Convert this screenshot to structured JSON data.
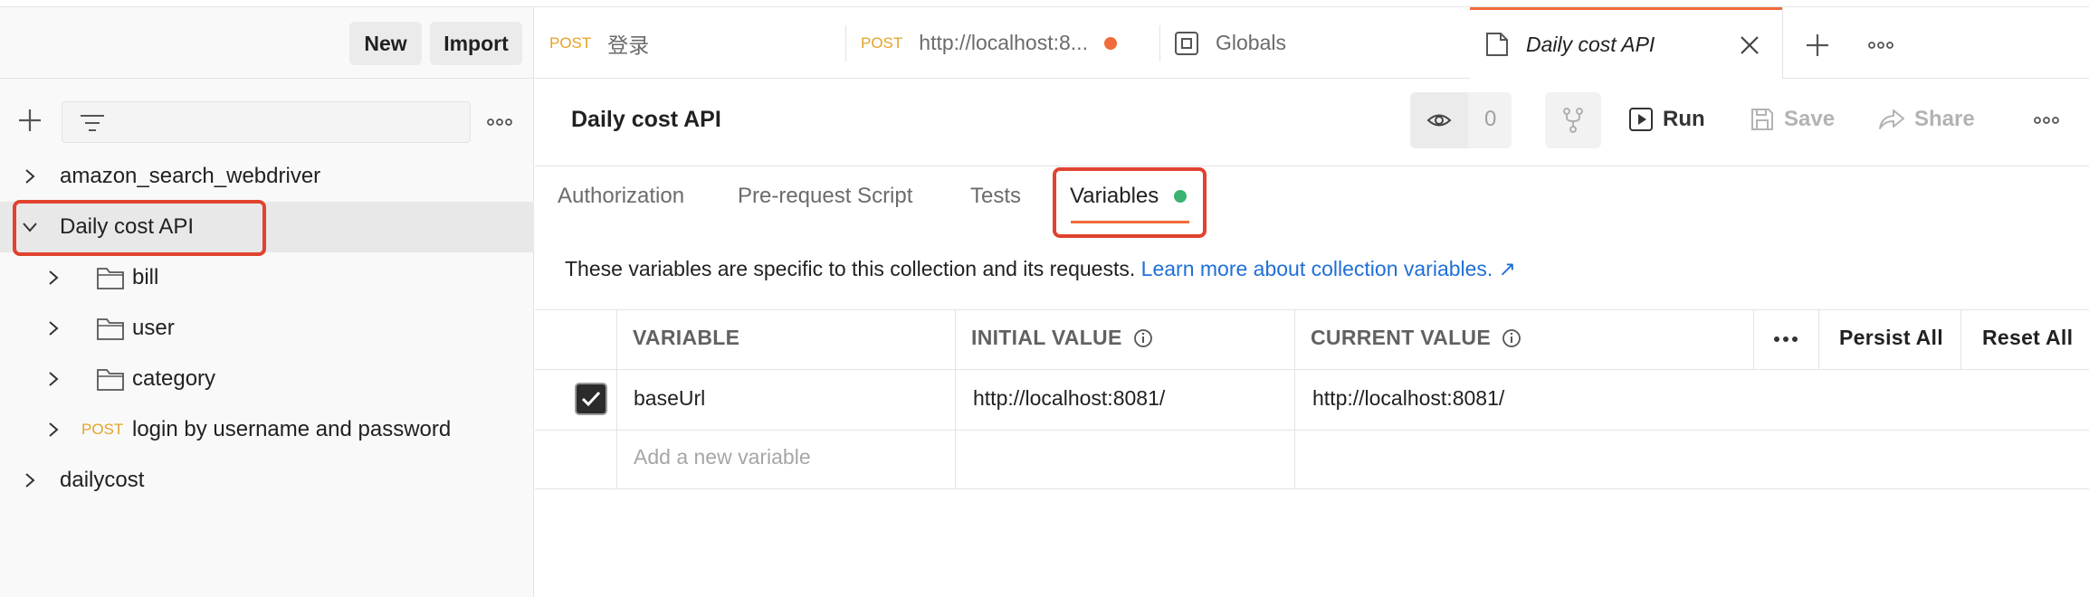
{
  "sidebar": {
    "new_label": "New",
    "import_label": "Import",
    "more_label": "ooo",
    "tree": [
      {
        "label": "amazon_search_webdriver",
        "expanded": false
      },
      {
        "label": "Daily cost API",
        "expanded": true,
        "selected": true
      },
      {
        "label": "bill",
        "type": "folder"
      },
      {
        "label": "user",
        "type": "folder"
      },
      {
        "label": "category",
        "type": "folder"
      },
      {
        "label": "login by username and password",
        "method": "POST"
      },
      {
        "label": "dailycost",
        "expanded": false
      }
    ]
  },
  "tabs": [
    {
      "method": "POST",
      "label": "登录"
    },
    {
      "method": "POST",
      "label": "http://localhost:8...",
      "unsaved_dot_color": "#f26b3a"
    },
    {
      "label": "Globals",
      "icon": "globals-icon"
    },
    {
      "label": "Daily cost API",
      "icon": "collection-icon",
      "active": true
    }
  ],
  "tabbar": {
    "new_tab_label": "+",
    "more_label": "ooo"
  },
  "header": {
    "title": "Daily cost API",
    "watch_count": "0",
    "run_label": "Run",
    "save_label": "Save",
    "share_label": "Share",
    "more_label": "ooo"
  },
  "subtabs": [
    {
      "label": "Authorization"
    },
    {
      "label": "Pre-request Script"
    },
    {
      "label": "Tests"
    },
    {
      "label": "Variables",
      "active": true,
      "dot_color": "#3cb371"
    }
  ],
  "description": {
    "text": "These variables are specific to this collection and its requests.",
    "link": "Learn more about collection variables. ↗"
  },
  "variables_table": {
    "columns": [
      "VARIABLE",
      "INITIAL VALUE",
      "CURRENT VALUE"
    ],
    "more_label": "ooo",
    "persist_all_label": "Persist All",
    "reset_all_label": "Reset All",
    "rows": [
      {
        "checked": true,
        "variable": "baseUrl",
        "initial": "http://localhost:8081/",
        "current": "http://localhost:8081/"
      }
    ],
    "new_placeholder": "Add a new variable"
  },
  "colors": {
    "accent": "#f26b3a",
    "highlight": "#e0432f",
    "link": "#1f6fd6",
    "post": "#e5a227"
  }
}
